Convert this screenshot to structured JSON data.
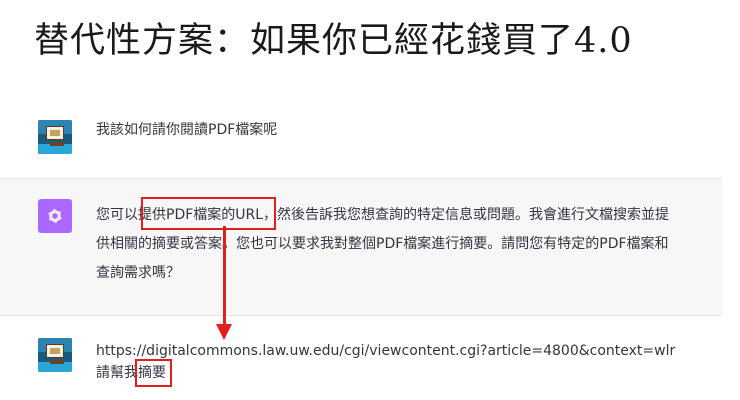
{
  "slide": {
    "title": "替代性方案：如果你已經花錢買了4.0"
  },
  "conversation": {
    "user_message_1": "我該如何請你閱讀PDF檔案呢",
    "assistant_message": {
      "line_1": "您可以提供PDF檔案的URL，然後告訴我您想查詢的特定信息或問題。我會進行文檔搜索並提",
      "line_2": "供相關的摘要或答案。您也可以要求我對整個PDF檔案進行摘要。請問您有特定的PDF檔案和",
      "line_3": "查詢需求嗎？"
    },
    "user_message_2": {
      "url": "https://digitalcommons.law.uw.edu/cgi/viewcontent.cgi?article=4800&context=wlr",
      "request": "請幫我摘要"
    }
  },
  "annotation_color": "#e0201e",
  "assistant_avatar_color": "#ab68ff",
  "icons": {
    "user_avatar": "teacher-classroom-avatar",
    "assistant_avatar": "openai-logo-icon"
  }
}
